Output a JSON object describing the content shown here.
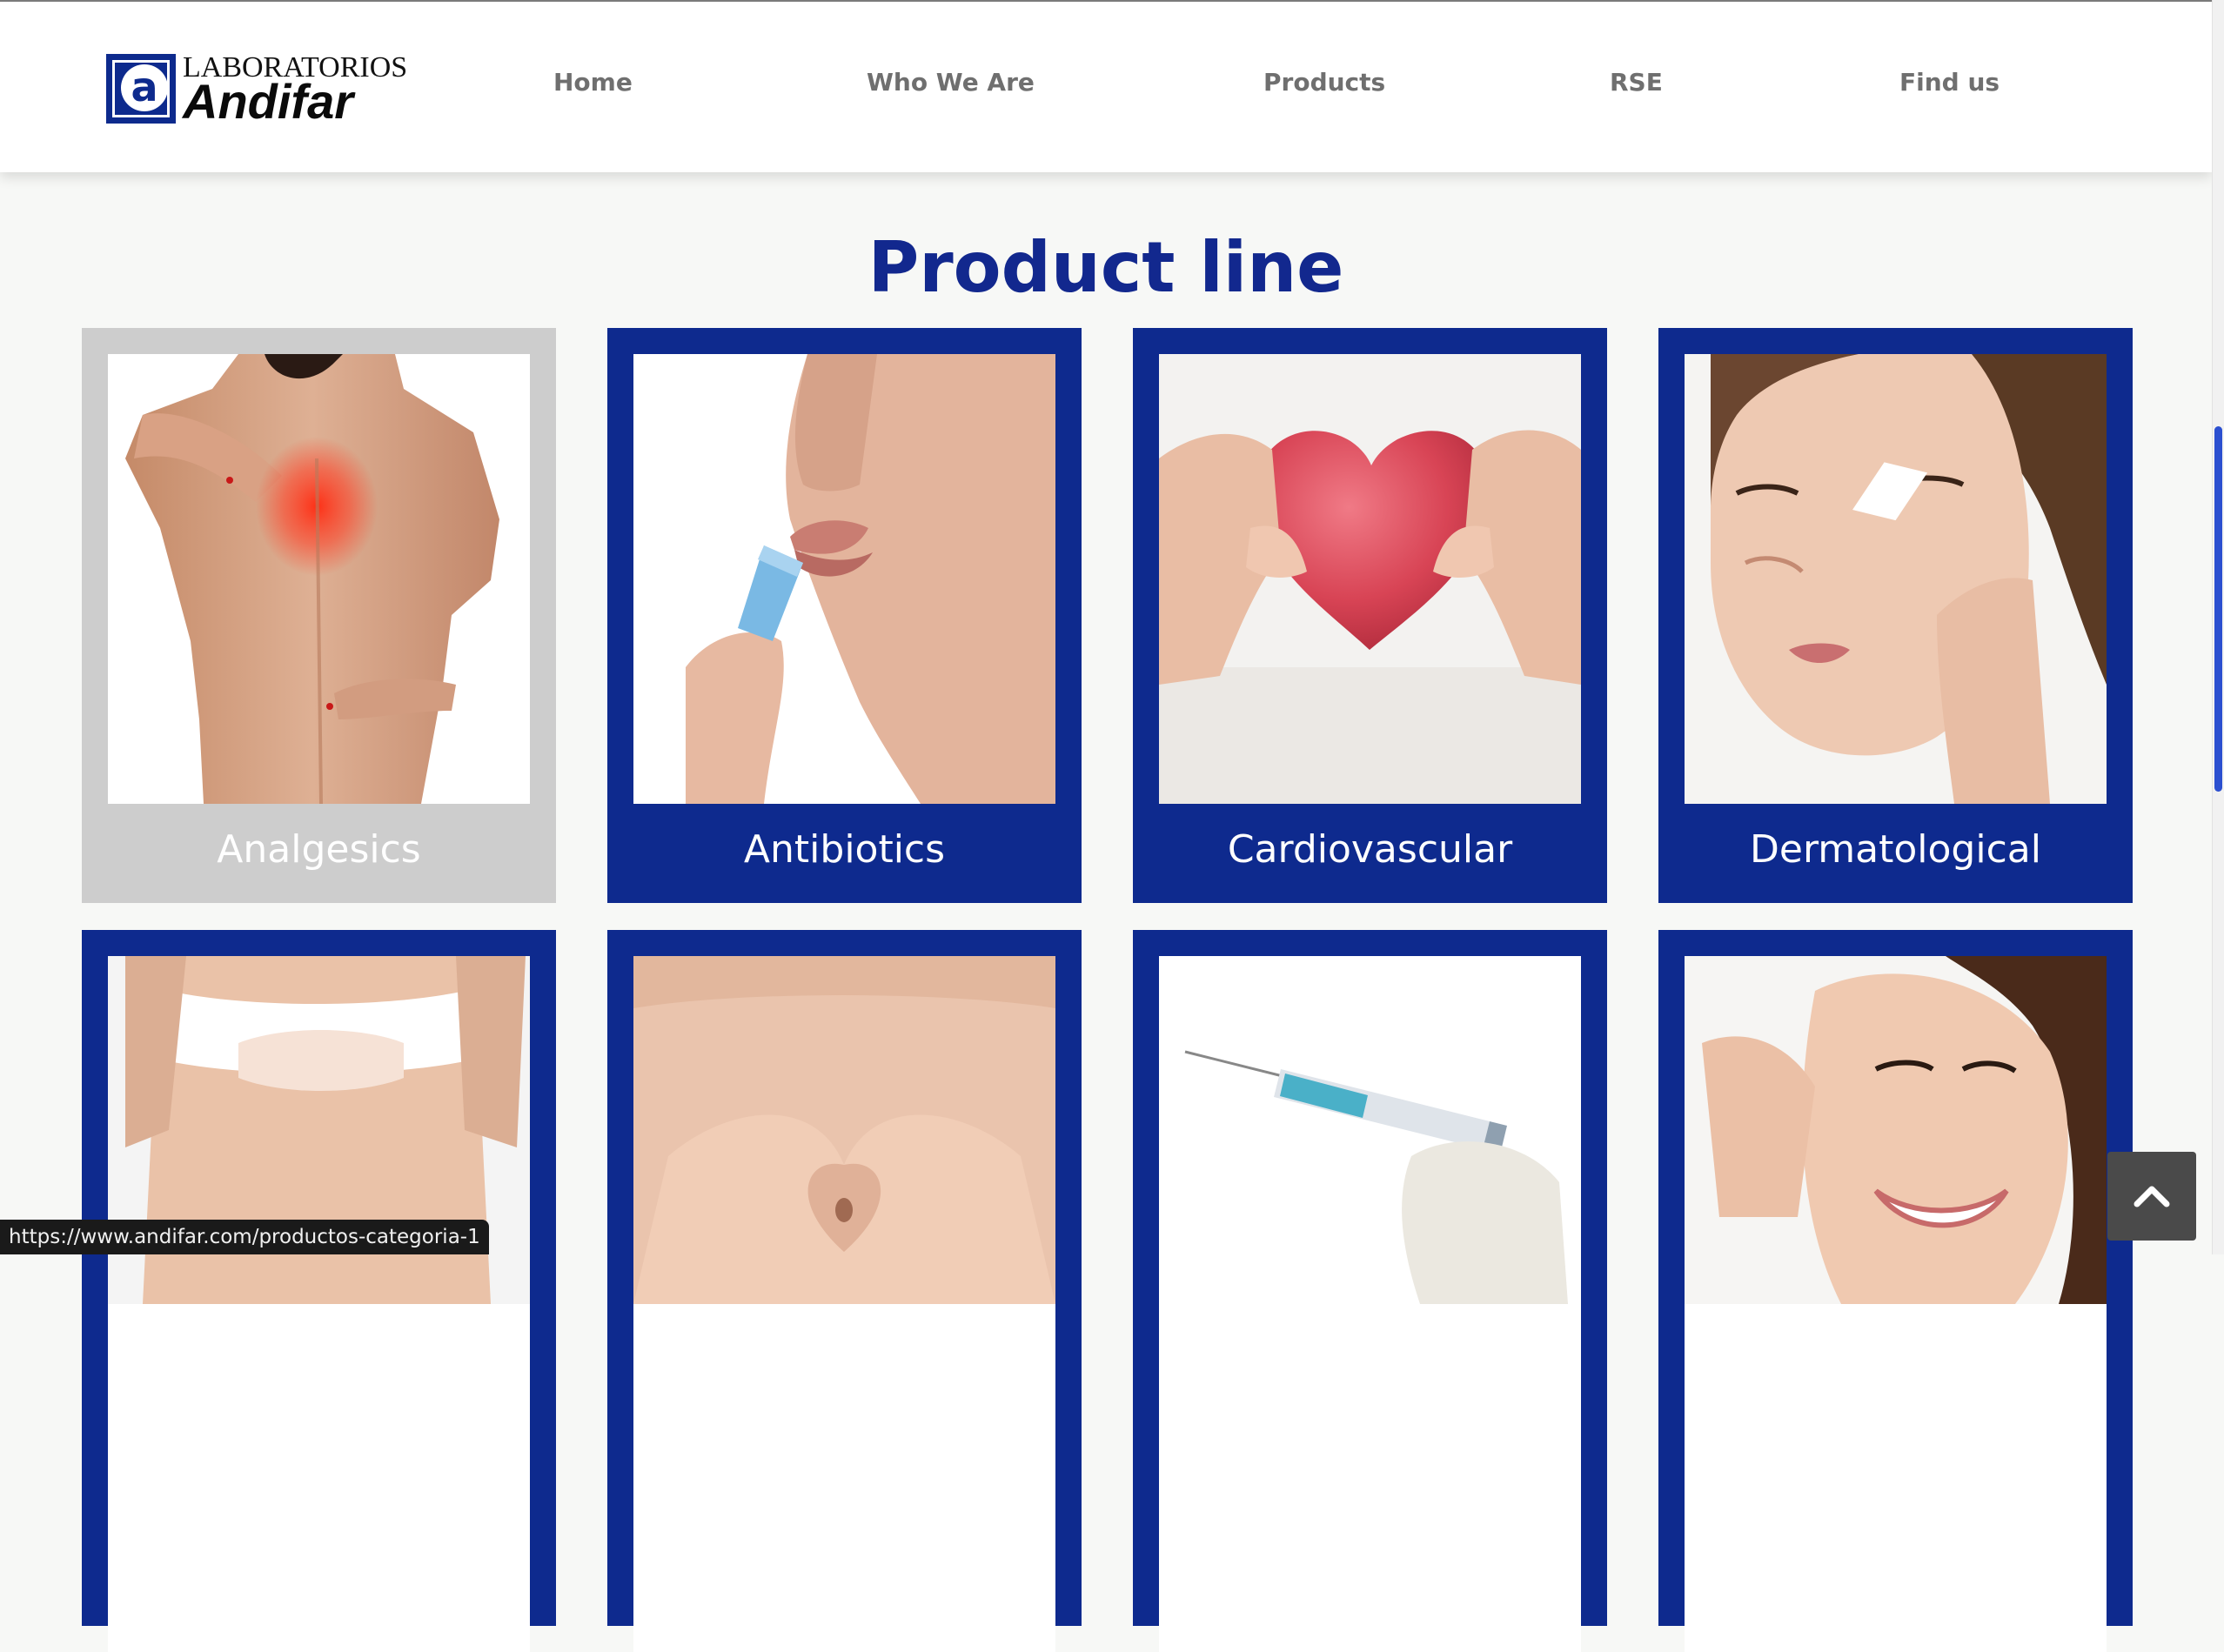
{
  "header": {
    "logo": {
      "top_text": "LABORATORIOS",
      "bottom_text": "Andifar",
      "mark_letter": "a"
    },
    "nav": [
      {
        "label": "Home"
      },
      {
        "label": "Who We Are"
      },
      {
        "label": "Products"
      },
      {
        "label": "RSE"
      },
      {
        "label": "Find us"
      }
    ]
  },
  "main": {
    "title": "Product line",
    "cards": [
      {
        "label": "Analgesics",
        "state": "hover"
      },
      {
        "label": "Antibiotics"
      },
      {
        "label": "Cardiovascular"
      },
      {
        "label": "Dermatological"
      },
      {
        "label": ""
      },
      {
        "label": ""
      },
      {
        "label": ""
      },
      {
        "label": ""
      }
    ]
  },
  "status_bar": {
    "url": "https://www.andifar.com/productos-categoria-1"
  },
  "back_to_top": {
    "icon": "chevron-up-icon"
  },
  "colors": {
    "brand_blue": "#0e2a8e",
    "title_blue": "#12288e",
    "nav_gray": "#6f6f6f",
    "card_hover_gray": "#cdcdcd",
    "page_background": "#f7f8f6"
  }
}
